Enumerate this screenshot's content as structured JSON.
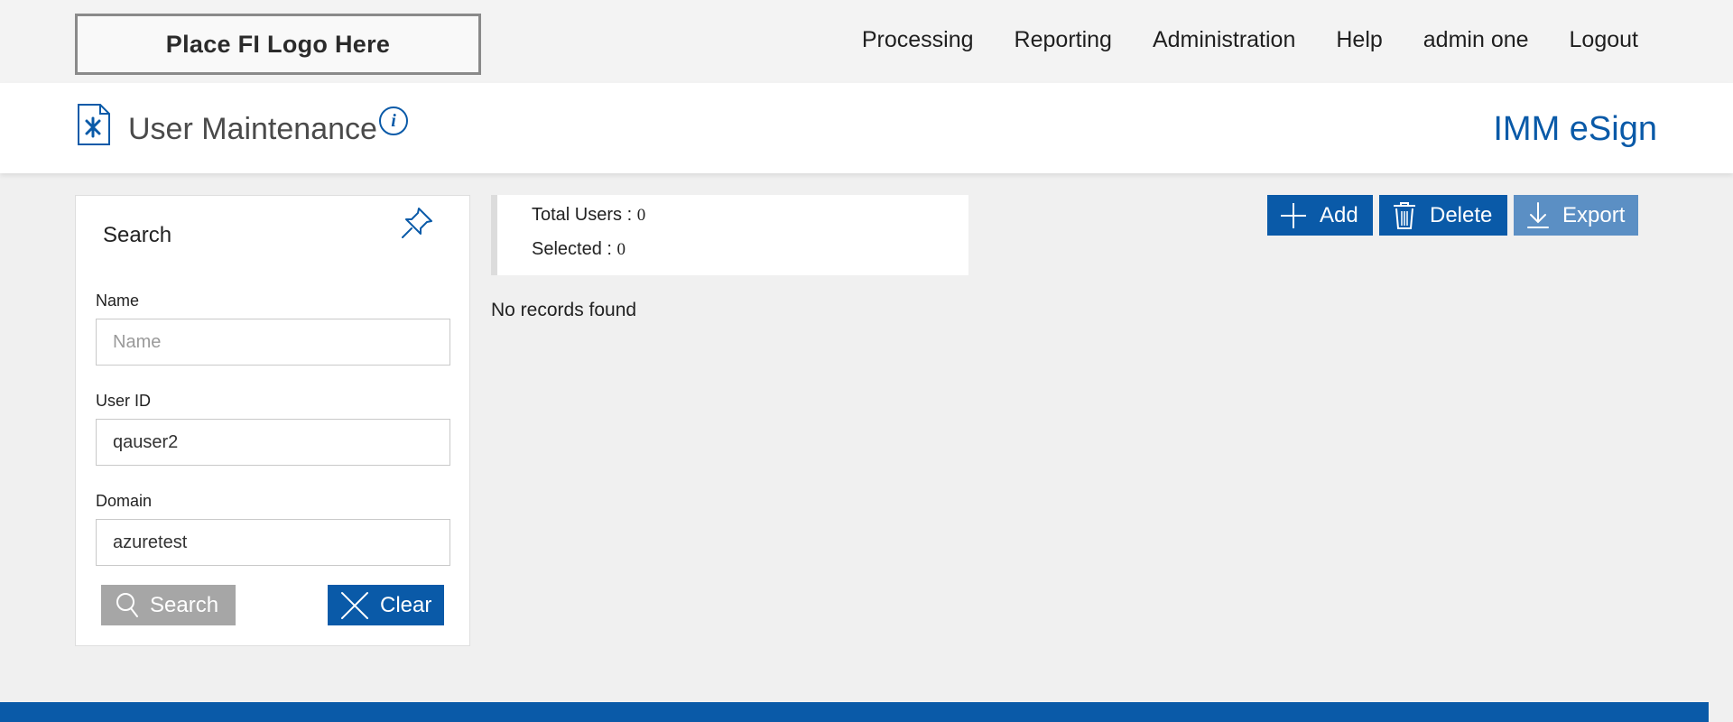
{
  "header": {
    "logo_text": "Place FI Logo Here",
    "nav": [
      "Processing",
      "Reporting",
      "Administration",
      "Help",
      "admin one",
      "Logout"
    ]
  },
  "titlebar": {
    "title": "User Maintenance",
    "info_glyph": "i",
    "brand": "IMM eSign"
  },
  "search": {
    "title": "Search",
    "fields": {
      "name": {
        "label": "Name",
        "placeholder": "Name",
        "value": ""
      },
      "user_id": {
        "label": "User ID",
        "placeholder": "",
        "value": "qauser2"
      },
      "domain": {
        "label": "Domain",
        "placeholder": "",
        "value": "azuretest"
      }
    },
    "search_label": "Search",
    "clear_label": "Clear"
  },
  "summary": {
    "total_label": "Total Users : ",
    "total_value": "0",
    "selected_label": "Selected : ",
    "selected_value": "0",
    "empty_message": "No records found"
  },
  "actions": {
    "add_label": "Add",
    "delete_label": "Delete",
    "export_label": "Export"
  },
  "colors": {
    "primary": "#0a5aa8",
    "export": "#5b8fc4",
    "disabled": "#a6a6a6",
    "background": "#f0f0f0"
  },
  "icons": {
    "page": "user-maintenance-icon",
    "info": "info-icon",
    "pin": "pin-icon",
    "search": "search-icon",
    "clear": "close-icon",
    "add": "plus-icon",
    "delete": "trash-icon",
    "export": "download-icon"
  }
}
